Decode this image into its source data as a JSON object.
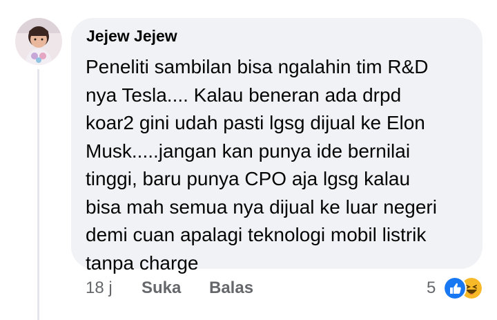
{
  "comment": {
    "author": "Jejew Jejew",
    "lines": [
      "Peneliti sambilan bisa ngalahin tim R&D",
      "nya Tesla.... Kalau beneran ada drpd",
      "koar2 gini udah pasti lgsg dijual ke Elon",
      "Musk.....jangan kan punya ide bernilai",
      "tinggi, baru punya CPO aja lgsg kalau",
      "bisa mah semua nya dijual ke luar negeri",
      "demi cuan apalagi teknologi mobil listrik",
      "tanpa charge"
    ],
    "time": "18 j",
    "like_label": "Suka",
    "reply_label": "Balas",
    "reaction_count": "5",
    "reactions": [
      "like-icon",
      "haha-icon"
    ]
  },
  "colors": {
    "bubble": "#f0f2f5",
    "text": "#050505",
    "meta": "#65676b",
    "like_blue": "#1877f2",
    "haha_yellow": "#f7b928"
  }
}
